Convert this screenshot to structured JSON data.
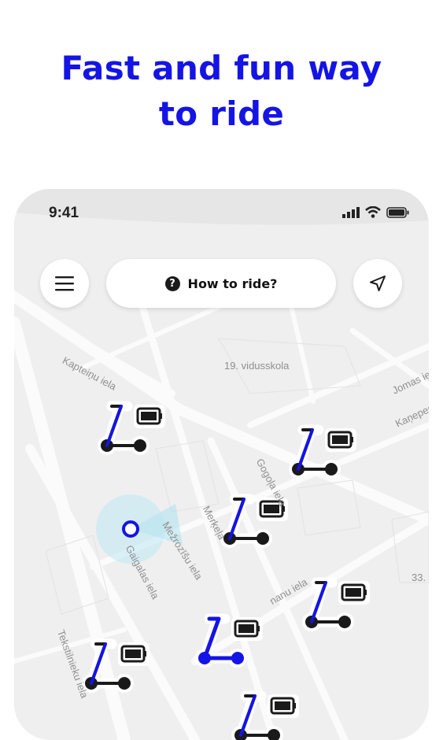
{
  "headline": {
    "line1": "Fast and fun way",
    "line2": "to ride"
  },
  "status_bar": {
    "time": "9:41",
    "icons": [
      "signal-icon",
      "wifi-icon",
      "battery-icon"
    ]
  },
  "toolbar": {
    "menu_icon": "menu-icon",
    "help_label": "How to ride?",
    "help_icon": "question-icon",
    "locate_icon": "navigation-arrow-icon"
  },
  "map": {
    "labels": {
      "school": "19. vidusskola",
      "kapteinu": "Kapteiņu iela",
      "jomas": "Jomas iela",
      "kanepes": "Kaņepes",
      "gogola": "Gogoļa iela",
      "merkela": "Merķeļa",
      "mezrozisu": "Mežrozīšu iela",
      "gaigalas": "Gaigalas iela",
      "nanu": "nanu iela",
      "tekstilnieku": "Tekstilnieku iela",
      "number": "33."
    },
    "scooter_icon": "scooter-icon",
    "battery_icon": "battery-full-icon"
  },
  "colors": {
    "accent": "#1414e6",
    "map_bg": "#efefef",
    "road": "#fbfbfb"
  }
}
